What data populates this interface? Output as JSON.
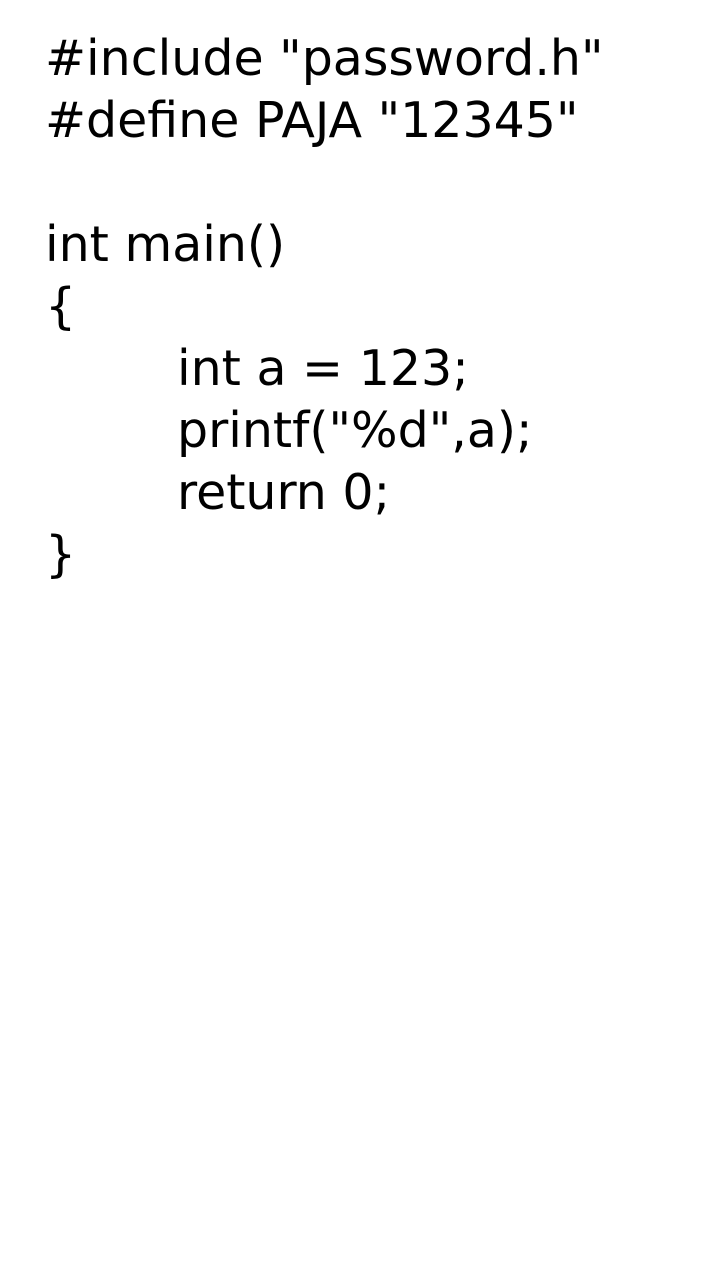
{
  "code": {
    "lines": [
      "#include \"password.h\"",
      "#define PAJA \"12345\"",
      "",
      "int main()",
      "{",
      "int a = 123;",
      "printf(\"%d\",a);",
      "return 0;",
      "}"
    ]
  }
}
